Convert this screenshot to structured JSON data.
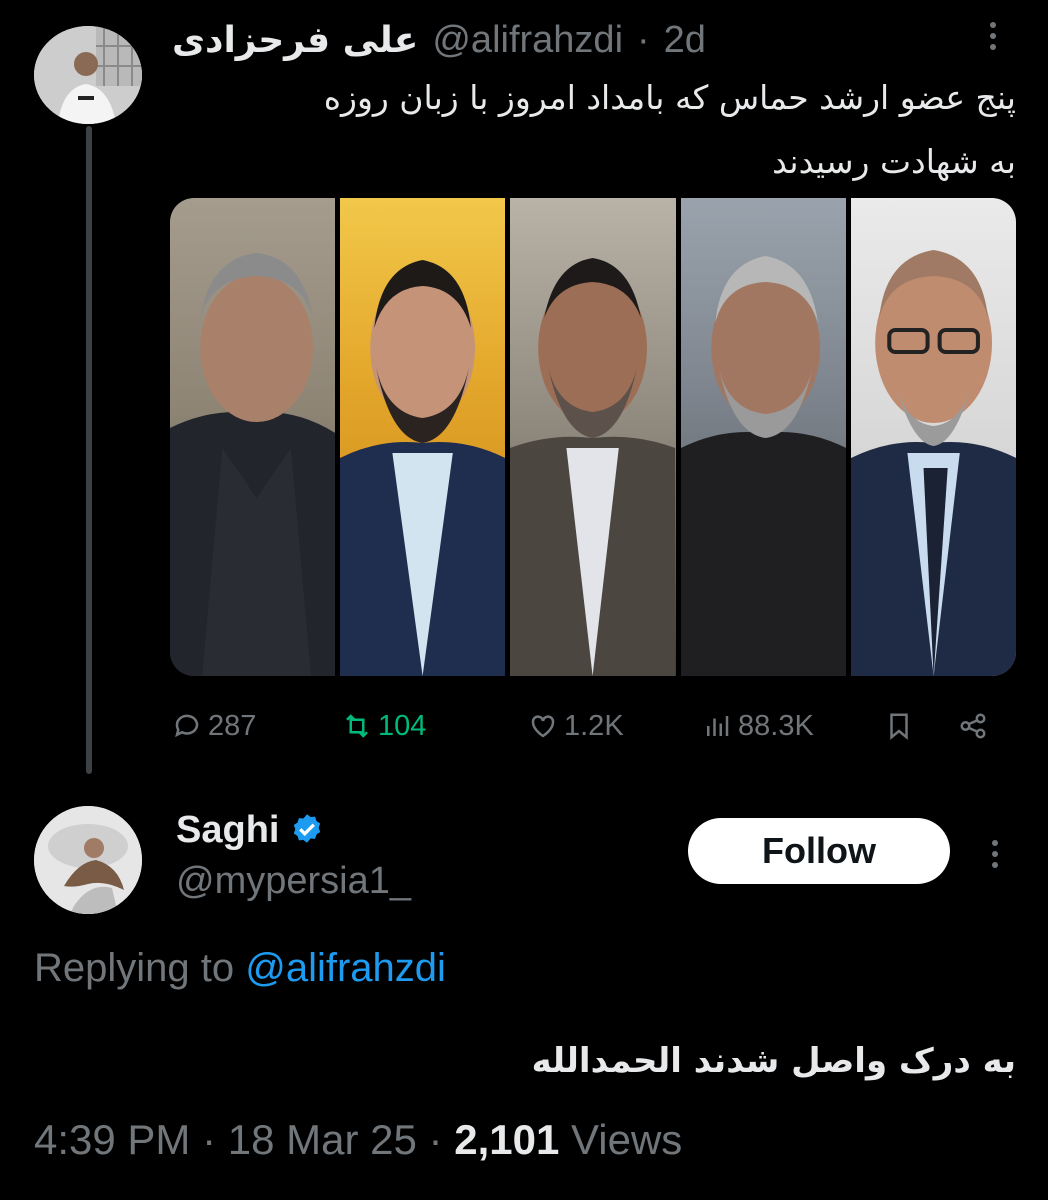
{
  "parent": {
    "display_name": "علی فرحزادی",
    "handle": "@alifrahzdi",
    "separator": "·",
    "age": "2d",
    "text_line1": "پنج عضو ارشد حماس که بامداد امروز با زبان روزه",
    "text_line2": "به شهادت رسیدند",
    "actions": {
      "replies": "287",
      "reposts": "104",
      "likes": "1.2K",
      "views": "88.3K"
    },
    "colors": {
      "repost_active": "#00ba7c",
      "muted": "#71767b"
    }
  },
  "reply": {
    "display_name": "Saghi",
    "verified": "verified-badge-icon",
    "handle": "@mypersia1_",
    "follow_label": "Follow",
    "replying_prefix": "Replying to",
    "replying_mention": "@alifrahzdi",
    "text": "به درک واصل شدند الحمدالله",
    "time": "4:39 PM",
    "date": "18 Mar 25",
    "separator": "·",
    "views_count": "2,101",
    "views_label": "Views",
    "colors": {
      "link": "#1d9bf0",
      "verified": "#1d9bf0"
    }
  }
}
